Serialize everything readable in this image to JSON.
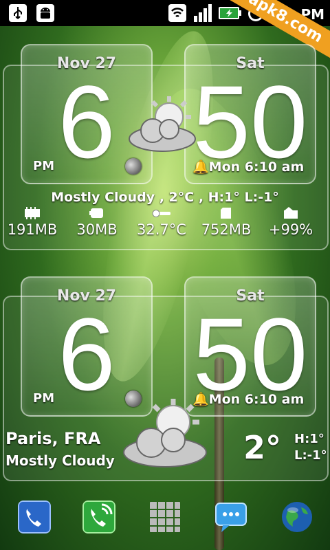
{
  "status_bar": {
    "time": "PM",
    "icons": [
      "usb-icon",
      "android-debug-icon",
      "wifi-icon",
      "signal-icon",
      "battery-charging-icon",
      "alarm-clock-icon"
    ],
    "watermark": "apk8.com"
  },
  "widget_top": {
    "date": "Nov  27",
    "day": "Sat",
    "hour": "6",
    "minute": "50",
    "ampm": "PM",
    "alarm": "Mon 6:10 am",
    "weather_line": "Mostly Cloudy , 2°C , H:1° L:-1°",
    "stats": [
      {
        "icon": "memory-chip-icon",
        "value": "191MB"
      },
      {
        "icon": "battery-icon",
        "value": "30MB"
      },
      {
        "icon": "thermometer-icon",
        "value": "32.7°C"
      },
      {
        "icon": "sd-card-icon",
        "value": "752MB"
      },
      {
        "icon": "battery-level-icon",
        "value": "+99%"
      }
    ]
  },
  "widget_bottom": {
    "date": "Nov  27",
    "day": "Sat",
    "hour": "6",
    "minute": "50",
    "ampm": "PM",
    "alarm": "Mon 6:10 am",
    "city": "Paris, FRA",
    "condition": "Mostly Cloudy",
    "temperature": "2°",
    "high": "H:1°",
    "low": "L:-1°"
  },
  "dock": {
    "icons": [
      "phone-icon",
      "dialer-icon",
      "app-drawer-icon",
      "messaging-icon",
      "browser-globe-icon"
    ]
  },
  "colors": {
    "watermark_orange": "#f0a020",
    "background_green": "#2f6a1e"
  }
}
